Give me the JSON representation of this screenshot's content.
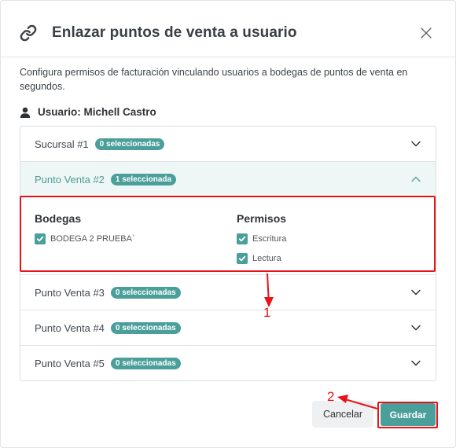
{
  "dialog": {
    "title": "Enlazar puntos de venta a usuario",
    "description": "Configura permisos de facturación vinculando usuarios a bodegas de puntos de venta en segundos.",
    "user_label": "Usuario: Michell Castro"
  },
  "accordion": {
    "items": [
      {
        "label": "Sucursal #1",
        "badge": "0 seleccionadas"
      },
      {
        "label": "Punto Venta #2",
        "badge": "1 seleccionada"
      },
      {
        "label": "Punto Venta #3",
        "badge": "0 seleccionadas"
      },
      {
        "label": "Punto Venta #4",
        "badge": "0 seleccionadas"
      },
      {
        "label": "Punto Venta #5",
        "badge": "0 seleccionadas"
      }
    ],
    "expanded": {
      "bodegas_heading": "Bodegas",
      "permisos_heading": "Permisos",
      "bodegas": [
        {
          "label": "BODEGA 2 PRUEBA`",
          "checked": true
        }
      ],
      "permisos": [
        {
          "label": "Escritura",
          "checked": true
        },
        {
          "label": "Lectura",
          "checked": true
        }
      ]
    }
  },
  "footer": {
    "cancel_label": "Cancelar",
    "save_label": "Guardar"
  },
  "annotations": {
    "step1": "1",
    "step2": "2"
  },
  "colors": {
    "accent": "#4b9f9a",
    "highlight": "#e8121a",
    "active_row_bg": "#eef7f6"
  },
  "icons": [
    "link-icon",
    "close-icon",
    "user-icon",
    "chevron-down-icon",
    "chevron-up-icon",
    "check-icon"
  ]
}
